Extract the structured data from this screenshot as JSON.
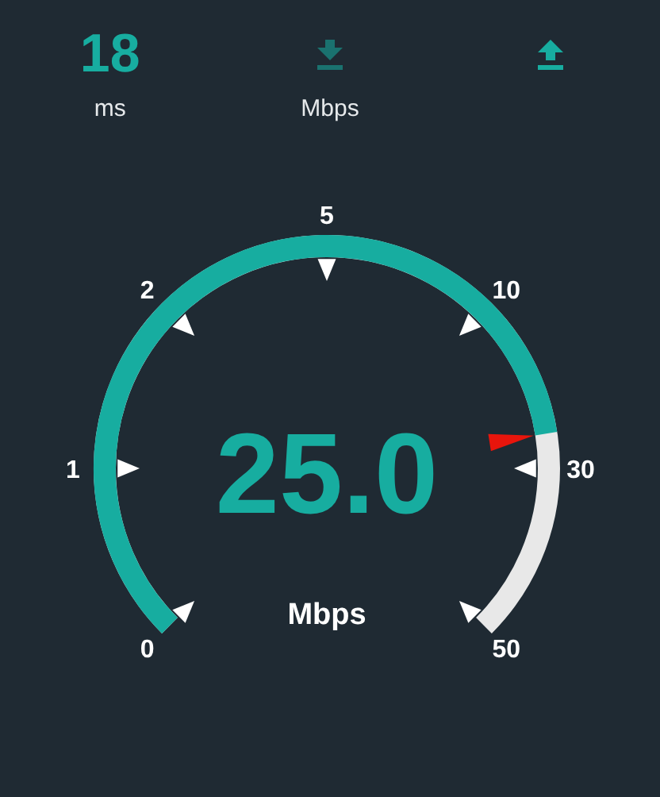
{
  "stats": [
    {
      "kind": "value",
      "value": "18",
      "unit": "ms"
    },
    {
      "kind": "download",
      "active": false,
      "unit": "Mbps"
    },
    {
      "kind": "upload",
      "active": true
    }
  ],
  "gauge": {
    "ticks": [
      "0",
      "1",
      "2",
      "5",
      "10",
      "30",
      "50"
    ],
    "reading": "25.0",
    "unit": "Mbps"
  }
}
